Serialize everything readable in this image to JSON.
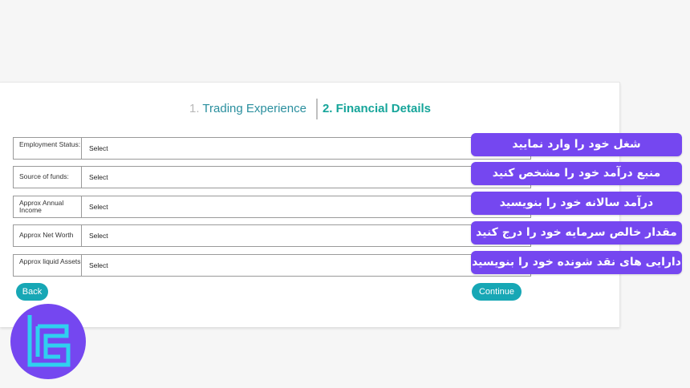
{
  "steps": [
    {
      "number": "1.",
      "label": "Trading Experience"
    },
    {
      "number": "2.",
      "label": "Financial Details"
    }
  ],
  "form": {
    "rows": [
      {
        "label": "Employment Status:",
        "value": "Select"
      },
      {
        "label": "Source of funds:",
        "value": "Select"
      },
      {
        "label": "Approx Annual Income",
        "value": "Select"
      },
      {
        "label": "Approx Net Worth",
        "value": "Select"
      },
      {
        "label": "Approx liquid Assets",
        "value": "Select"
      }
    ],
    "back_label": "Back",
    "continue_label": "Continue"
  },
  "notes": [
    "شغل خود را وارد نمایید",
    "منبع درآمد خود را مشخص کنید",
    "درآمد سالانه خود را بنویسید",
    "مقدار خالص سرمایه خود را درج کنید",
    "دارایی های نقد شونده خود را بنویسید"
  ],
  "colors": {
    "accent_teal": "#17a7b5",
    "note_purple": "#7547f0",
    "logo_cyan": "#2fd0f0"
  },
  "logo": {
    "icon": "tradingfinder-logo-icon"
  }
}
